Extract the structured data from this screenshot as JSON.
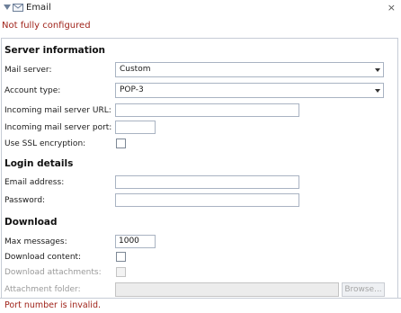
{
  "header": {
    "title": "Email",
    "status": "Not fully configured",
    "close_symbol": "×"
  },
  "server": {
    "heading": "Server information",
    "mail_server_label": "Mail server:",
    "mail_server_value": "Custom",
    "account_type_label": "Account type:",
    "account_type_value": "POP-3",
    "url_label": "Incoming mail server URL:",
    "url_value": "",
    "port_label": "Incoming mail server port:",
    "port_value": "",
    "ssl_label": "Use SSL encryption:",
    "ssl_checked": false
  },
  "login": {
    "heading": "Login details",
    "email_label": "Email address:",
    "email_value": "",
    "password_label": "Password:",
    "password_value": ""
  },
  "download": {
    "heading": "Download",
    "max_label": "Max messages:",
    "max_value": "1000",
    "content_label": "Download content:",
    "content_checked": false,
    "attachments_label": "Download attachments:",
    "attachments_checked": false,
    "folder_label": "Attachment folder:",
    "folder_value": "",
    "browse_label": "Browse..."
  },
  "footer": {
    "error": "Port number is invalid."
  },
  "colors": {
    "error_red": "#a0241b",
    "border": "#a9b3c2",
    "disabled_text": "#9a9a9a"
  }
}
